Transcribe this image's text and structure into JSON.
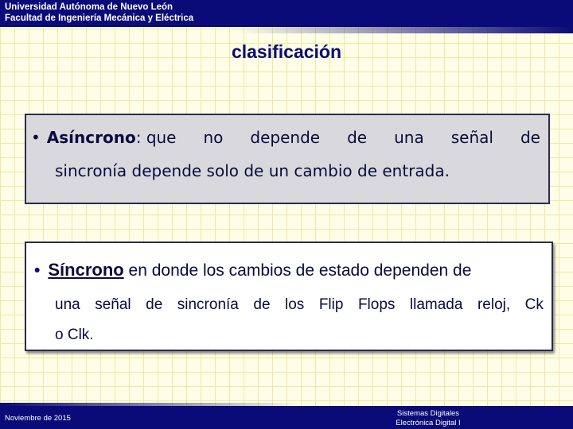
{
  "header": {
    "line1": "Universidad Autónoma de Nuevo León",
    "line2": "Facultad de Ingeniería Mecánica y Eléctrica"
  },
  "title": "clasificación",
  "box1": {
    "bullet": "•",
    "term": "Asíncrono",
    "row1_words": [
      ": que",
      "no",
      "depende",
      "de",
      "una",
      "señal",
      "de"
    ],
    "row2": "sincronía depende solo de un cambio de entrada."
  },
  "box2": {
    "bullet": "•",
    "term": "Síncrono",
    "row1_rest": " en donde los cambios de estado dependen de",
    "row2_words": [
      "una",
      "señal",
      "de",
      "sincronía",
      "de",
      "los",
      "Flip",
      "Flops",
      "llamada",
      "reloj,",
      "Ck"
    ],
    "row3": "o Clk."
  },
  "footer": {
    "date": "Noviembre de 2015",
    "course_line1": "Sistemas Digitales",
    "course_line2": "Electrónica Digital I"
  },
  "colors": {
    "navy": "#0a0a78",
    "background": "#fdfde8",
    "grid": "#ecec9e",
    "box_gray": "#d9d9dd"
  }
}
